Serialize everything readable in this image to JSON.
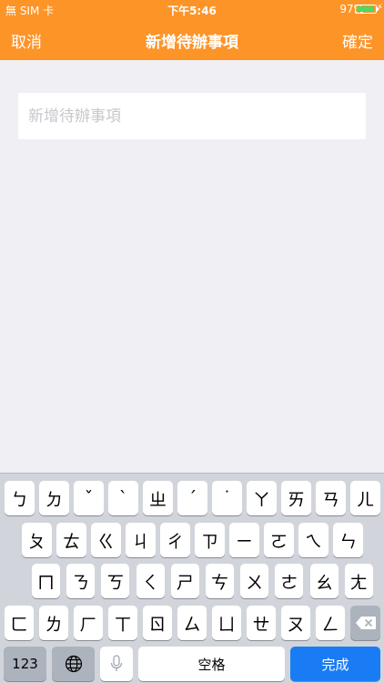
{
  "status": {
    "carrier": "無 SIM 卡",
    "time": "下午5:46",
    "battery_text": "97%",
    "battery_level": 0.97,
    "accent": "#fd9428"
  },
  "navbar": {
    "cancel": "取消",
    "title": "新增待辦事項",
    "confirm": "確定"
  },
  "input": {
    "placeholder": "新增待辦事項",
    "value": ""
  },
  "keyboard": {
    "rows": [
      [
        "ㄅ",
        "ㄉ",
        "ˇ",
        "ˋ",
        "ㄓ",
        "ˊ",
        "˙",
        "ㄚ",
        "ㄞ",
        "ㄢ",
        "ㄦ"
      ],
      [
        "ㄆ",
        "ㄊ",
        "ㄍ",
        "ㄐ",
        "ㄔ",
        "ㄗ",
        "ㄧ",
        "ㄛ",
        "ㄟ",
        "ㄣ"
      ],
      [
        "ㄇ",
        "ㄋ",
        "ㄎ",
        "ㄑ",
        "ㄕ",
        "ㄘ",
        "ㄨ",
        "ㄜ",
        "ㄠ",
        "ㄤ"
      ],
      [
        "ㄈ",
        "ㄌ",
        "ㄏ",
        "ㄒ",
        "ㄖ",
        "ㄙ",
        "ㄩ",
        "ㄝ",
        "ㄡ",
        "ㄥ"
      ]
    ],
    "numbers_key": "123",
    "space_key": "空格",
    "done_key": "完成",
    "globe_icon": "globe-icon",
    "mic_icon": "microphone-icon",
    "delete_icon": "backspace-icon"
  }
}
